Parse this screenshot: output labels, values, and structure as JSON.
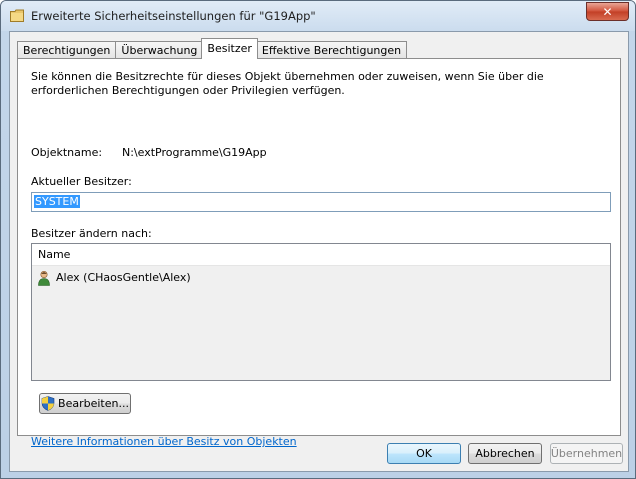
{
  "window": {
    "title": "Erweiterte Sicherheitseinstellungen für \"G19App\"",
    "close_glyph": "✕"
  },
  "tabs": [
    {
      "label": "Berechtigungen",
      "active": false
    },
    {
      "label": "Überwachung",
      "active": false
    },
    {
      "label": "Besitzer",
      "active": true
    },
    {
      "label": "Effektive Berechtigungen",
      "active": false
    }
  ],
  "owner_page": {
    "description": "Sie können die Besitzrechte für dieses Objekt übernehmen oder zuweisen, wenn Sie über die erforderlichen Berechtigungen oder Privilegien verfügen.",
    "object_name_label": "Objektname:",
    "object_name_value": "N:\\extProgramme\\G19App",
    "current_owner_label": "Aktueller Besitzer:",
    "current_owner_value": "SYSTEM",
    "change_owner_label": "Besitzer ändern nach:",
    "list": {
      "column_header": "Name",
      "rows": [
        {
          "name": "Alex (CHaosGentle\\Alex)",
          "icon": "user-icon"
        }
      ]
    },
    "edit_button": "Bearbeiten...",
    "info_link": "Weitere Informationen über Besitz von Objekten"
  },
  "footer": {
    "ok_label": "OK",
    "cancel_label": "Abbrechen",
    "apply_label": "Übernehmen"
  },
  "colors": {
    "link": "#0066cc",
    "selection": "#3399ff",
    "close_button": "#c23f26"
  }
}
